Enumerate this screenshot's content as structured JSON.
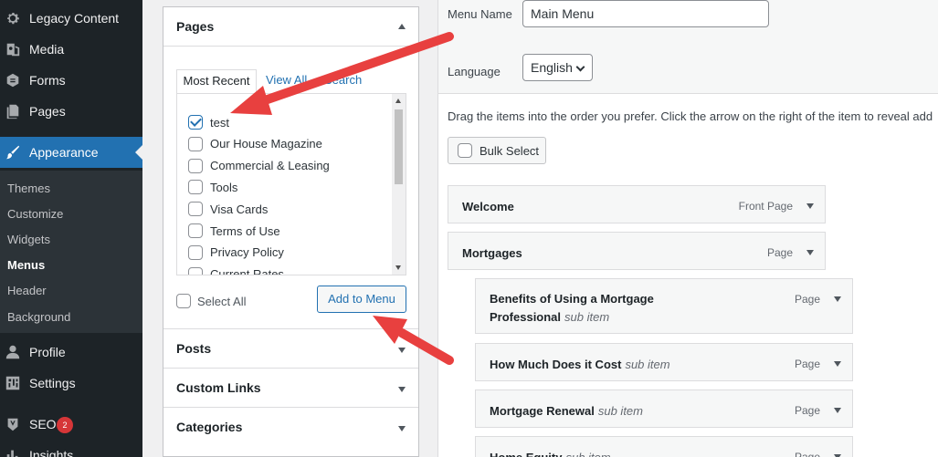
{
  "sidebar": {
    "items": [
      {
        "label": "Legacy Content",
        "icon": "gear-icon"
      },
      {
        "label": "Media",
        "icon": "media-icon"
      },
      {
        "label": "Forms",
        "icon": "forms-icon"
      },
      {
        "label": "Pages",
        "icon": "pages-icon"
      },
      {
        "label": "Appearance",
        "icon": "brush-icon"
      },
      {
        "label": "Profile",
        "icon": "user-icon"
      },
      {
        "label": "Settings",
        "icon": "settings-icon"
      },
      {
        "label": "SEO",
        "icon": "seo-icon",
        "badge": "2"
      },
      {
        "label": "Insights",
        "icon": "insights-icon"
      }
    ],
    "submenu": [
      "Themes",
      "Customize",
      "Widgets",
      "Menus",
      "Header",
      "Background"
    ],
    "active_submenu": "Menus",
    "accent_color": "#2271b1"
  },
  "accordion": {
    "pages": {
      "title": "Pages",
      "tabs": [
        "Most Recent",
        "View All",
        "Search"
      ],
      "items": [
        {
          "label": "test",
          "checked": true
        },
        {
          "label": "Our House Magazine",
          "checked": false
        },
        {
          "label": "Commercial & Leasing",
          "checked": false
        },
        {
          "label": "Tools",
          "checked": false
        },
        {
          "label": "Visa Cards",
          "checked": false
        },
        {
          "label": "Terms of Use",
          "checked": false
        },
        {
          "label": "Privacy Policy",
          "checked": false
        },
        {
          "label": "Current Rates",
          "checked": false
        }
      ],
      "select_all": "Select All",
      "add_button": "Add to Menu"
    },
    "sections": [
      "Posts",
      "Custom Links",
      "Categories"
    ]
  },
  "menu_edit": {
    "name_label": "Menu Name",
    "name_value": "Main Menu",
    "language_label": "Language",
    "language_value": "English",
    "instructions": "Drag the items into the order you prefer. Click the arrow on the right of the item to reveal add",
    "bulk_select": "Bulk Select",
    "items": [
      {
        "title": "Welcome",
        "type": "Front Page",
        "sub": ""
      },
      {
        "title": "Mortgages",
        "type": "Page",
        "sub": ""
      },
      {
        "title": "Benefits of Using a Mortgage Professional",
        "type": "Page",
        "sub": "sub item"
      },
      {
        "title": "How Much Does it Cost",
        "type": "Page",
        "sub": "sub item"
      },
      {
        "title": "Mortgage Renewal",
        "type": "Page",
        "sub": "sub item"
      },
      {
        "title": "Home Equity",
        "type": "Page",
        "sub": "sub item"
      }
    ]
  },
  "annotation_color": "#e8403f"
}
